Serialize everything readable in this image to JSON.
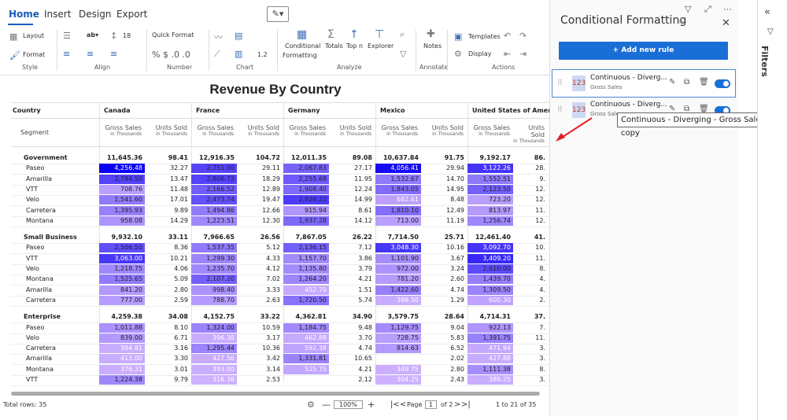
{
  "menu": {
    "tabs": [
      "Home",
      "Insert",
      "Design",
      "Export"
    ],
    "active": "Home"
  },
  "ribbon": {
    "layout_label": "Layout",
    "format_label": "Format",
    "style_group": "Style",
    "align_group": "Align",
    "indent_value": "18",
    "quick_format": "Quick Format",
    "number_group": "Number",
    "number_symbols": "% $ .0 .0",
    "chart_group": "Chart",
    "chart_value": "1.2",
    "conditional_label": "Conditional",
    "formatting_label": "Formatting",
    "totals_label": "Totals",
    "topn_label": "Top n",
    "explorer_label": "Explorer",
    "analyze_group": "Analyze",
    "notes_label": "Notes",
    "annotate_group": "Annotate",
    "templates_label": "Templates",
    "display_label": "Display",
    "actions_group": "Actions"
  },
  "report": {
    "title": "Revenue By Country"
  },
  "table": {
    "country_header": "Country",
    "segment_header": "Segment",
    "countries": [
      "Canada",
      "France",
      "Germany",
      "Mexico",
      "United States of America"
    ],
    "measure_headers": [
      {
        "name": "Gross Sales",
        "unit": "in Thousands"
      },
      {
        "name": "Units Sold",
        "unit": "in Thousands"
      }
    ],
    "rows": [
      {
        "label": "Government",
        "bold": true,
        "values": [
          "11,645.36",
          "98.41",
          "12,916.35",
          "104.72",
          "12,011.35",
          "89.08",
          "10,637.84",
          "91.75",
          "9,192.17",
          "86."
        ]
      },
      {
        "label": "Paseo",
        "values": [
          "4,256.48",
          "32.27",
          "2,751.00",
          "29.11",
          "2,067.83",
          "27.17",
          "4,056.41",
          "29.94",
          "3,122.26",
          "28."
        ]
      },
      {
        "label": "Amarilla",
        "values": [
          "2,784.50",
          "13.47",
          "2,806.72",
          "18.29",
          "2,255.68",
          "11.95",
          "1,532.67",
          "14.70",
          "1,552.51",
          "9."
        ]
      },
      {
        "label": "VTT",
        "values": [
          "708.76",
          "11.48",
          "2,166.52",
          "12.89",
          "1,908.40",
          "12.24",
          "1,843.05",
          "14.95",
          "2,123.50",
          "12."
        ]
      },
      {
        "label": "Velo",
        "values": [
          "1,541.60",
          "17.01",
          "2,473.74",
          "19.47",
          "2,926.22",
          "14.99",
          "682.61",
          "8.48",
          "723.20",
          "12."
        ]
      },
      {
        "label": "Carretera",
        "values": [
          "1,395.93",
          "9.89",
          "1,494.86",
          "12.66",
          "915.94",
          "8.61",
          "1,810.10",
          "12.49",
          "813.97",
          "11."
        ]
      },
      {
        "label": "Montana",
        "values": [
          "958.08",
          "14.29",
          "1,223.51",
          "12.30",
          "1,937.28",
          "14.12",
          "713.00",
          "11.19",
          "1,256.74",
          "12."
        ]
      },
      {
        "label": "",
        "values": []
      },
      {
        "label": "Small Business",
        "bold": true,
        "values": [
          "9,932.10",
          "33.11",
          "7,966.65",
          "26.56",
          "7,867.05",
          "26.22",
          "7,714.50",
          "25.71",
          "12,461.40",
          "41."
        ]
      },
      {
        "label": "Paseo",
        "values": [
          "2,506.50",
          "8.36",
          "1,537.35",
          "5.12",
          "2,136.15",
          "7.12",
          "3,048.30",
          "10.16",
          "3,092.70",
          "10."
        ]
      },
      {
        "label": "VTT",
        "values": [
          "3,063.00",
          "10.21",
          "1,299.30",
          "4.33",
          "1,157.70",
          "3.86",
          "1,101.90",
          "3.67",
          "3,409.20",
          "11."
        ]
      },
      {
        "label": "Velo",
        "values": [
          "1,218.75",
          "4.06",
          "1,235.70",
          "4.12",
          "1,135.80",
          "3.79",
          "972.00",
          "3.24",
          "2,610.00",
          "8."
        ]
      },
      {
        "label": "Montana",
        "values": [
          "1,525.65",
          "5.09",
          "2,107.20",
          "7.02",
          "1,264.20",
          "4.21",
          "781.20",
          "2.60",
          "1,439.70",
          "4."
        ]
      },
      {
        "label": "Amarilla",
        "values": [
          "841.20",
          "2.80",
          "998.40",
          "3.33",
          "452.70",
          "1.51",
          "1,422.60",
          "4.74",
          "1,309.50",
          "4."
        ]
      },
      {
        "label": "Carretera",
        "values": [
          "777.00",
          "2.59",
          "788.70",
          "2.63",
          "1,720.50",
          "5.74",
          "388.50",
          "1.29",
          "600.30",
          "2."
        ]
      },
      {
        "label": "",
        "values": []
      },
      {
        "label": "Enterprise",
        "bold": true,
        "values": [
          "4,259.38",
          "34.08",
          "4,152.75",
          "33.22",
          "4,362.81",
          "34.90",
          "3,579.75",
          "28.64",
          "4,714.31",
          "37."
        ]
      },
      {
        "label": "Paseo",
        "values": [
          "1,011.88",
          "8.10",
          "1,324.00",
          "10.59",
          "1,184.75",
          "9.48",
          "1,129.75",
          "9.04",
          "922.13",
          "7."
        ]
      },
      {
        "label": "Velo",
        "values": [
          "839.00",
          "6.71",
          "396.38",
          "3.17",
          "462.88",
          "3.70",
          "728.75",
          "5.83",
          "1,391.75",
          "11."
        ]
      },
      {
        "label": "Carretera",
        "values": [
          "394.81",
          "3.16",
          "1,295.44",
          "10.36",
          "592.38",
          "4.74",
          "814.63",
          "6.52",
          "471.94",
          "3."
        ]
      },
      {
        "label": "Amarilla",
        "values": [
          "413.00",
          "3.30",
          "427.56",
          "3.42",
          "1,331.81",
          "10.65",
          "252.63",
          "2.02",
          "427.88",
          "3."
        ]
      },
      {
        "label": "Montana",
        "values": [
          "376.31",
          "3.01",
          "393.00",
          "3.14",
          "525.75",
          "4.21",
          "349.75",
          "2.80",
          "1,111.38",
          "8."
        ]
      },
      {
        "label": "VTT",
        "values": [
          "1,224.38",
          "9.79",
          "316.38",
          "2.53",
          "265.25",
          "2.12",
          "304.25",
          "2.43",
          "389.25",
          "3."
        ]
      }
    ]
  },
  "footer": {
    "total_rows": "Total rows: 35",
    "zoom": "100%",
    "page_label": "Page",
    "page_num": "1",
    "page_of": "of 2",
    "range": "1 to 21 of 35"
  },
  "panel": {
    "title": "Conditional Formatting",
    "add_rule": "+ Add new rule",
    "rules": [
      {
        "name": "Continuous - Diverg...",
        "measure": "Gross Sales",
        "thumb": "123"
      },
      {
        "name": "Continuous - Diverg...",
        "measure": "Gross Sales",
        "thumb": "123"
      }
    ],
    "tooltip": "Continuous - Diverging - Gross Sales-copy"
  },
  "filters": {
    "label": "Filters"
  },
  "colors": {
    "accent": "#1a6fd6",
    "cell_scale_low": "#ffffff",
    "cell_scale_high": "#1a1aff"
  }
}
